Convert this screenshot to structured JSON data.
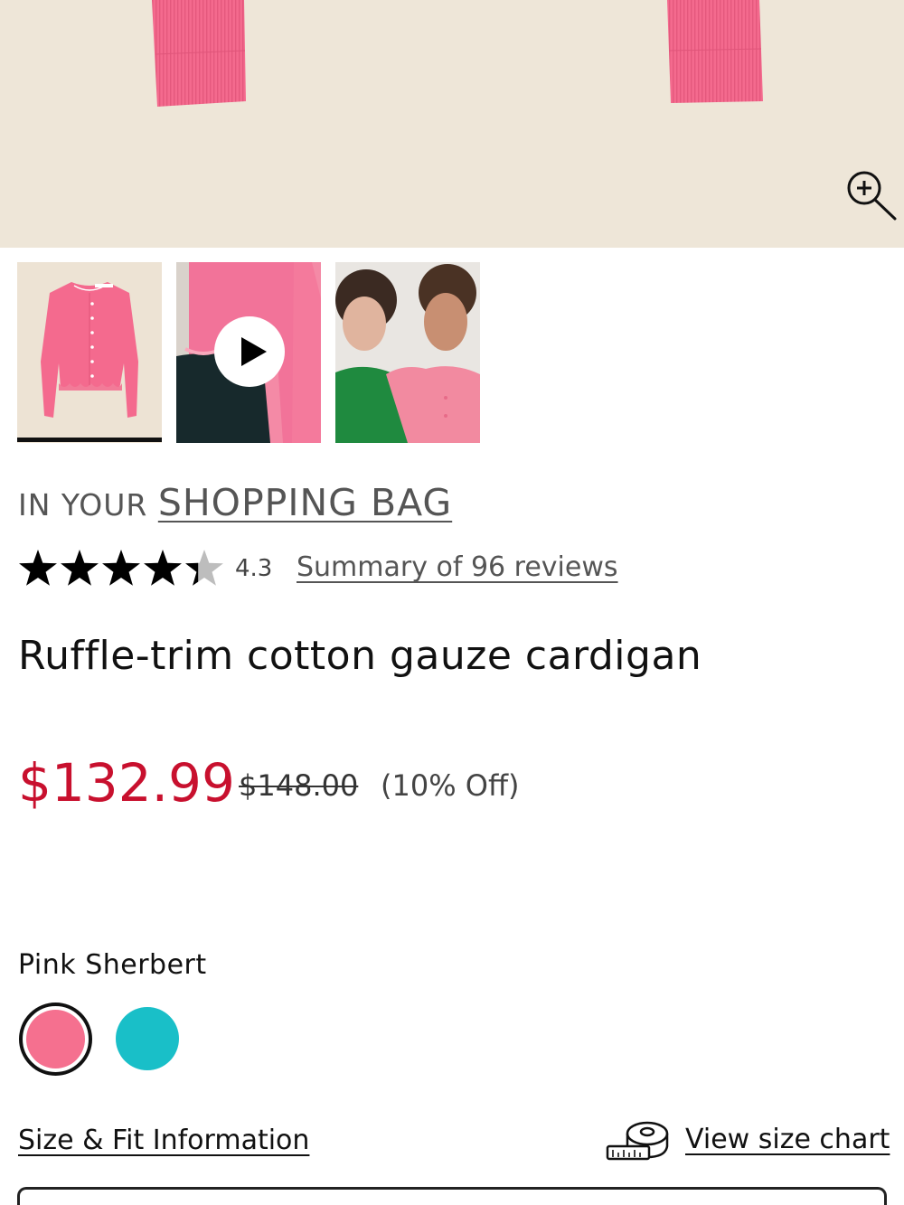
{
  "colors": {
    "sale_price": "#c8102e",
    "hero_background": "#eee6d8",
    "product_pink": "#f46a8e",
    "swatch_pink": "#f5708f",
    "swatch_teal": "#19bfc8"
  },
  "hero": {
    "zoom_icon": "zoom-in-icon"
  },
  "thumbnails": [
    {
      "name": "flat-lay-image",
      "selected": true
    },
    {
      "name": "video-image",
      "icon": "play-icon"
    },
    {
      "name": "models-image"
    }
  ],
  "bag_notice": {
    "prefix": "IN YOUR ",
    "link": "SHOPPING BAG"
  },
  "rating": {
    "value": "4.3",
    "stars": 4.3,
    "reviews_link": "Summary of 96 reviews"
  },
  "product": {
    "title": "Ruffle-trim cotton gauze cardigan",
    "sale_price": "$132.99",
    "original_price": "$148.00",
    "discount": "(10% Off)"
  },
  "color_selector": {
    "selected_name": "Pink Sherbert",
    "swatches": [
      {
        "color": "#f5708f",
        "selected": true
      },
      {
        "color": "#19bfc8",
        "selected": false
      }
    ]
  },
  "size": {
    "fit_link": "Size & Fit Information",
    "chart_icon": "tape-measure-icon",
    "chart_link": "View size chart"
  }
}
